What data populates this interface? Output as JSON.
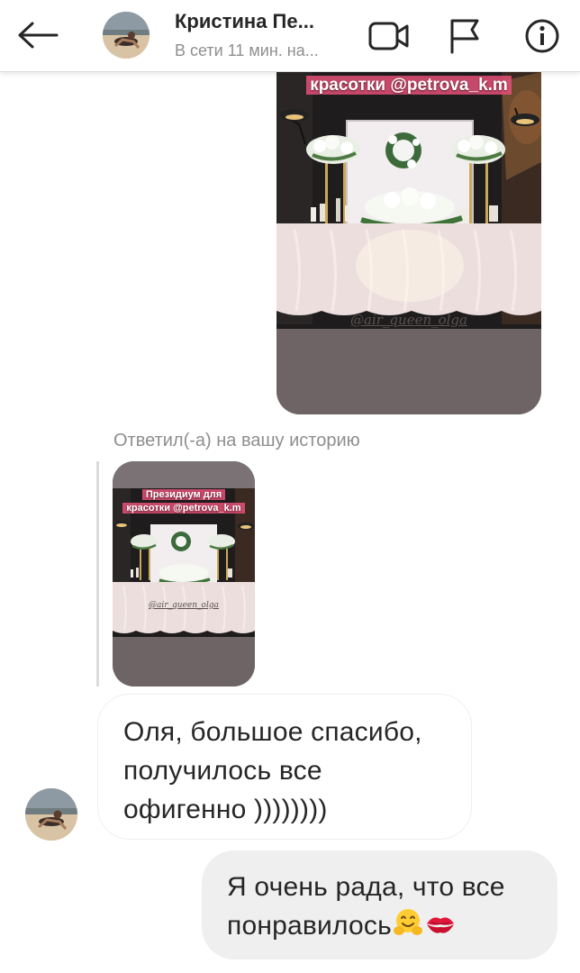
{
  "header": {
    "back_icon": "arrow-left-icon",
    "user_name": "Кристина Пе...",
    "status": "В сети 11 мин. на...",
    "icons": [
      "video-camera-icon",
      "flag-icon",
      "info-icon"
    ]
  },
  "thread": {
    "sent_story": {
      "caption": "красотки @petrova_k.m",
      "watermark": "@air_queen_olga"
    },
    "reply": {
      "label": "Ответил(-а) на вашу историю",
      "story_caption_line1": "Президиум для",
      "story_caption_line2": "красотки @petrova_k.m",
      "story_watermark": "@air_queen_olga"
    },
    "received_message": {
      "line1": "Оля, большое спасибо,",
      "line2": "получилось все",
      "line3": "офигенно ))))))))"
    },
    "sent_message": {
      "line1": "Я очень рада, что все",
      "line2": "понравилось",
      "emojis": [
        "hugging-face-icon",
        "kiss-mark-icon"
      ]
    }
  },
  "colors": {
    "header_bg": "#ffffff",
    "outgoing_bubble": "#efefef",
    "incoming_border": "#efefef",
    "secondary_text": "#8e8e8e",
    "caption_highlight": "#e65078"
  }
}
